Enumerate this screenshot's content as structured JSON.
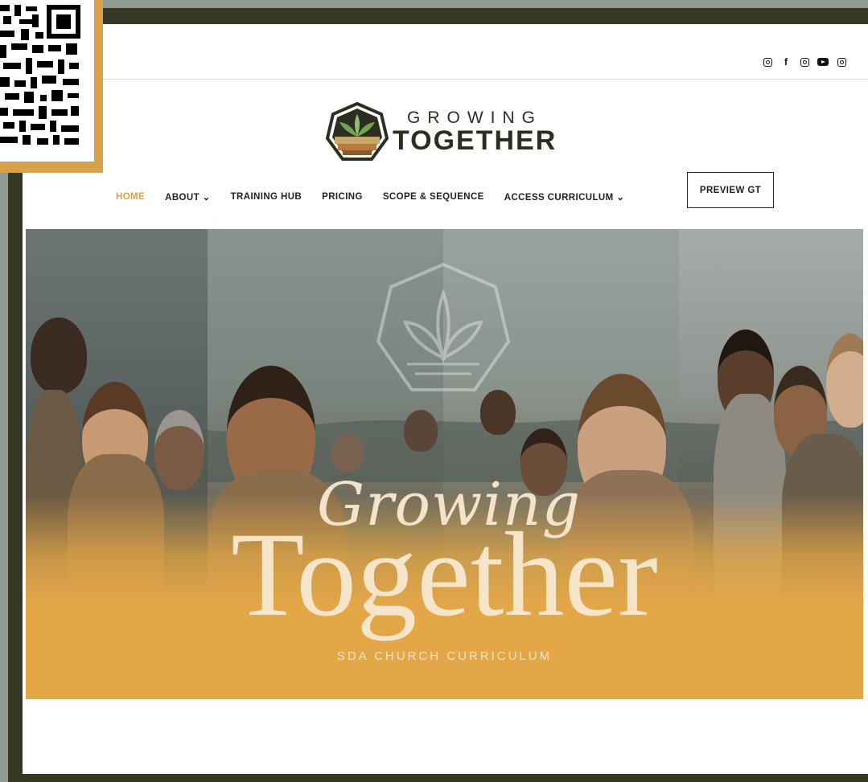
{
  "social": {
    "icons": [
      "instagram-icon",
      "facebook-icon",
      "instagram-icon",
      "youtube-icon",
      "instagram-icon"
    ],
    "facebook_glyph": "f"
  },
  "logo": {
    "line1": "GROWING",
    "line2": "TOGETHER"
  },
  "nav": {
    "items": [
      {
        "label": "HOME",
        "active": true
      },
      {
        "label": "ABOUT ⌄"
      },
      {
        "label": "TRAINING HUB"
      },
      {
        "label": "PRICING"
      },
      {
        "label": "SCOPE & SEQUENCE"
      },
      {
        "label": "ACCESS CURRICULUM ⌄"
      }
    ],
    "cta": "PREVIEW GT"
  },
  "hero": {
    "script_text": "Growing",
    "title": "Together",
    "subtitle": "SDA CHURCH CURRICULUM"
  },
  "colors": {
    "accent": "#e4a748",
    "frame": "#363a22",
    "background": "#8f9c95",
    "nav_active": "#d8a14a"
  }
}
